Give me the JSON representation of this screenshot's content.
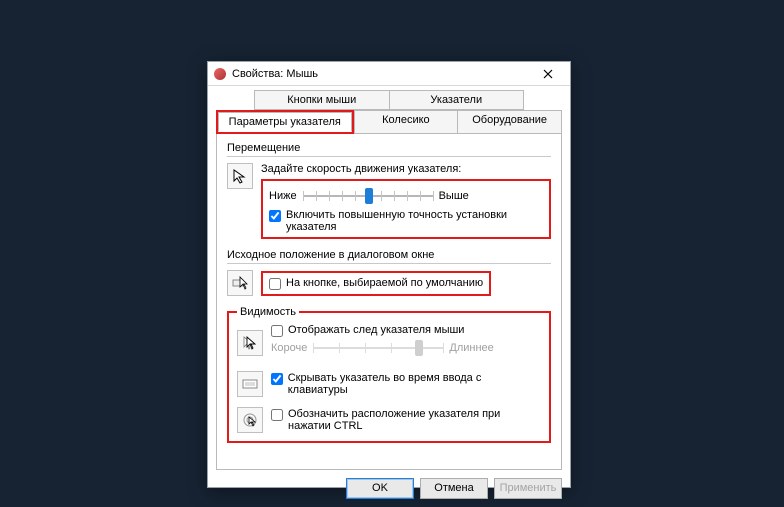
{
  "window": {
    "title": "Свойства: Мышь"
  },
  "tabs": {
    "row1": [
      "Кнопки мыши",
      "Указатели"
    ],
    "row2": [
      "Параметры указателя",
      "Колесико",
      "Оборудование"
    ],
    "active": "Параметры указателя"
  },
  "movement": {
    "group_label": "Перемещение",
    "instr": "Задайте скорость движения указателя:",
    "slow": "Ниже",
    "fast": "Выше",
    "slider_value": 6,
    "enhance_label": "Включить повышенную точность установки указателя",
    "enhance_checked": true
  },
  "snap": {
    "group_label": "Исходное положение в диалоговом окне",
    "label": "На кнопке, выбираемой по умолчанию",
    "checked": false
  },
  "visibility": {
    "legend": "Видимость",
    "trails_label": "Отображать след указателя мыши",
    "trails_checked": false,
    "trails_short": "Короче",
    "trails_long": "Длиннее",
    "hide_label": "Скрывать указатель во время ввода с клавиатуры",
    "hide_checked": true,
    "locate_label": "Обозначить расположение указателя при нажатии CTRL",
    "locate_checked": false
  },
  "buttons": {
    "ok": "OK",
    "cancel": "Отмена",
    "apply": "Применить"
  }
}
